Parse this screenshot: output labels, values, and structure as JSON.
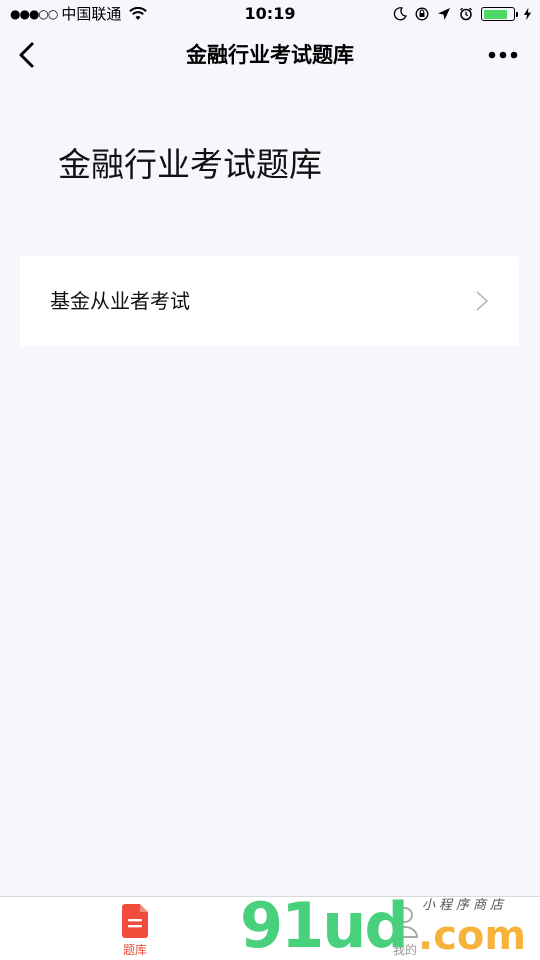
{
  "status_bar": {
    "signal_dots": "●●●○○",
    "carrier": "中国联通",
    "time": "10:19",
    "battery_level": 0.8,
    "battery_color": "#4cd964"
  },
  "nav": {
    "title": "金融行业考试题库",
    "back_icon": "chevron-left-icon",
    "more_icon": "more-dots-icon"
  },
  "page": {
    "heading": "金融行业考试题库"
  },
  "list": {
    "items": [
      {
        "label": "基金从业者考试",
        "icon": "chevron-right-icon"
      }
    ]
  },
  "tabbar": {
    "tabs": [
      {
        "label": "题库",
        "icon": "document-icon",
        "active": true,
        "color": "#f14c3b"
      },
      {
        "label": "我的",
        "icon": "user-icon",
        "active": false,
        "color": "#999999"
      }
    ]
  },
  "watermark": {
    "main": "91ud",
    "com": ".com",
    "small": "小程序商店"
  }
}
